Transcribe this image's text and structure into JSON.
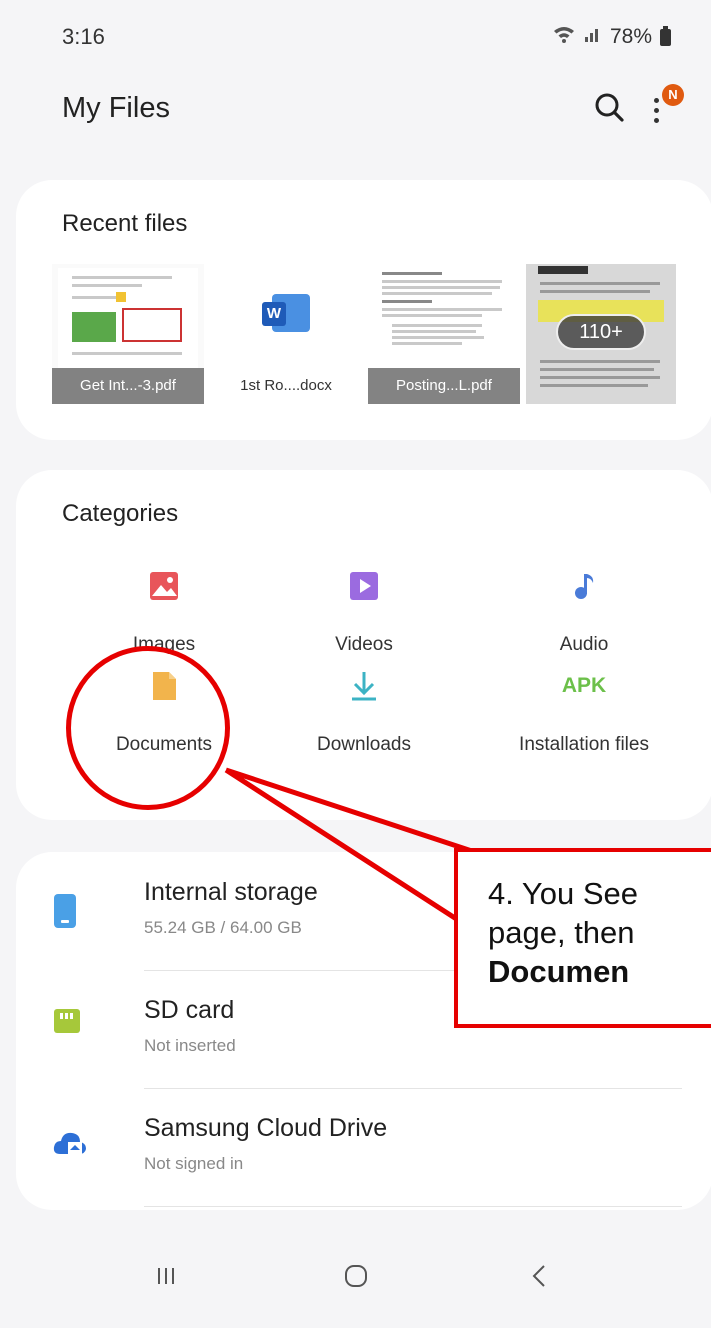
{
  "status_bar": {
    "time": "3:16",
    "battery": "78%"
  },
  "header": {
    "title": "My Files",
    "avatar_initial": "N"
  },
  "recent": {
    "title": "Recent files",
    "files": [
      {
        "name": "Get Int...-3.pdf"
      },
      {
        "name": "1st Ro....docx"
      },
      {
        "name": "Posting...L.pdf"
      },
      {
        "name": "110+"
      }
    ]
  },
  "categories": {
    "title": "Categories",
    "items": [
      {
        "label": "Images",
        "icon": "image-icon"
      },
      {
        "label": "Videos",
        "icon": "video-icon"
      },
      {
        "label": "Audio",
        "icon": "music-note-icon"
      },
      {
        "label": "Documents",
        "icon": "document-icon"
      },
      {
        "label": "Downloads",
        "icon": "download-icon"
      },
      {
        "label": "Installation files",
        "icon": "apk-icon",
        "glyph": "APK"
      }
    ]
  },
  "storage": [
    {
      "name": "Internal storage",
      "sub": "55.24 GB / 64.00 GB"
    },
    {
      "name": "SD card",
      "sub": "Not inserted"
    },
    {
      "name": "Samsung Cloud Drive",
      "sub": "Not signed in"
    }
  ],
  "annotation": {
    "line1": "4. You See",
    "line2": "page, then",
    "line3": "Documen"
  },
  "colors": {
    "images": "#e8555a",
    "videos": "#9b6be0",
    "audio": "#4a7bd8",
    "documents": "#f2b44c",
    "downloads": "#3cb3c4",
    "apk": "#6cc04a",
    "internal": "#4aa0e6",
    "sdcard": "#a6c83a",
    "cloud": "#2d6fd6",
    "callout": "#e60000"
  }
}
